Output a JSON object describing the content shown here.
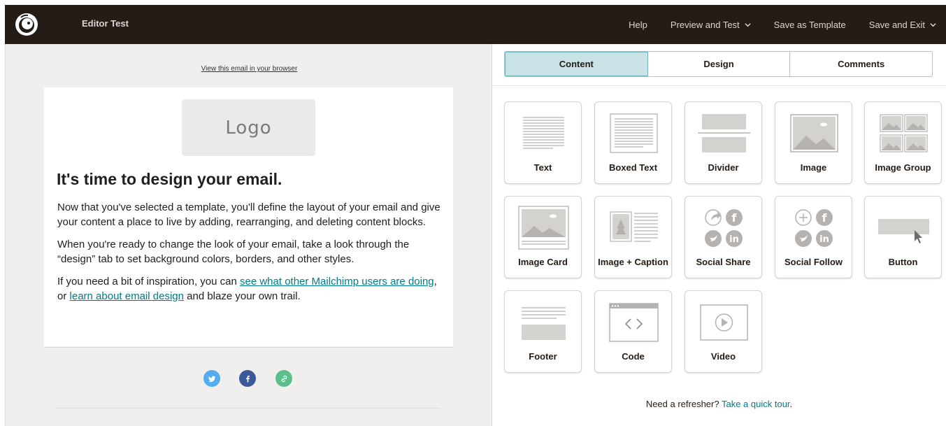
{
  "app": {
    "title": "Editor Test",
    "brand_color": "#241c15",
    "accent_color": "#007c89"
  },
  "nav": {
    "help": "Help",
    "preview": "Preview and Test",
    "save_template": "Save as Template",
    "save_exit": "Save and Exit"
  },
  "email": {
    "browser_link": "View this email in your browser",
    "logo_placeholder": "Logo",
    "heading": "It's time to design your email.",
    "p1": "Now that you've selected a template, you'll define the layout of your email and give your content a place to live by adding, rearranging, and deleting content blocks.",
    "p2": "When you're ready to change the look of your email, take a look through the “design” tab to set background colors, borders, and other styles.",
    "p3_start": "If you need a bit of inspiration, you can ",
    "p3_link1": "see what other Mailchimp users are doing",
    "p3_mid": ", or ",
    "p3_link2": "learn about email design",
    "p3_end": " and blaze your own trail.",
    "social_icons": [
      "twitter-icon",
      "facebook-icon",
      "link-icon"
    ]
  },
  "tabs": [
    "Content",
    "Design",
    "Comments"
  ],
  "active_tab": "Content",
  "blocks": [
    {
      "label": "Text",
      "icon": "text-block-icon"
    },
    {
      "label": "Boxed Text",
      "icon": "boxed-text-block-icon"
    },
    {
      "label": "Divider",
      "icon": "divider-block-icon"
    },
    {
      "label": "Image",
      "icon": "image-block-icon"
    },
    {
      "label": "Image Group",
      "icon": "image-group-block-icon"
    },
    {
      "label": "Image Card",
      "icon": "image-card-block-icon"
    },
    {
      "label": "Image + Caption",
      "icon": "image-caption-block-icon"
    },
    {
      "label": "Social Share",
      "icon": "social-share-block-icon"
    },
    {
      "label": "Social Follow",
      "icon": "social-follow-block-icon"
    },
    {
      "label": "Button",
      "icon": "button-block-icon"
    },
    {
      "label": "Footer",
      "icon": "footer-block-icon"
    },
    {
      "label": "Code",
      "icon": "code-block-icon"
    },
    {
      "label": "Video",
      "icon": "video-block-icon"
    }
  ],
  "refresher": {
    "text": "Need a refresher? ",
    "link": "Take a quick tour",
    "end": "."
  }
}
